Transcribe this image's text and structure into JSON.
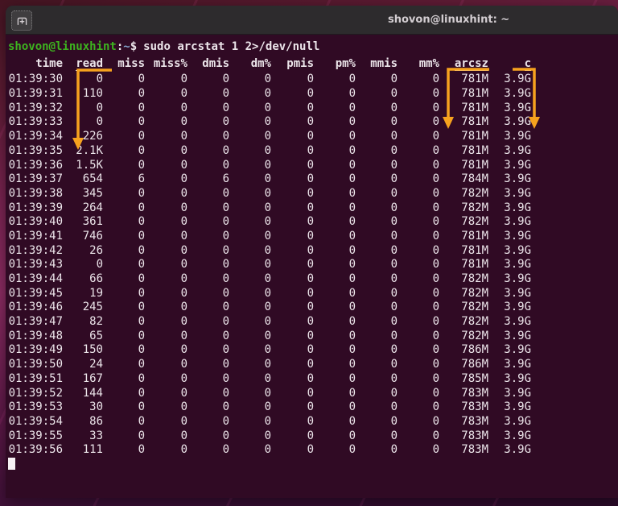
{
  "window": {
    "title": "shovon@linuxhint: ~"
  },
  "titlebar": {
    "new_tab_button": "new-tab"
  },
  "terminal": {
    "prompt": {
      "user_host": "shovon@linuxhint",
      "colon": ":",
      "path": "~",
      "symbol": "$"
    },
    "command": "sudo arcstat 1 2>/dev/null",
    "cursor": "block"
  },
  "table": {
    "columns": [
      "time",
      "read",
      "miss",
      "miss%",
      "dmis",
      "dm%",
      "pmis",
      "pm%",
      "mmis",
      "mm%",
      "arcsz",
      "c"
    ],
    "underlined_columns": [
      "read",
      "arcsz",
      "c"
    ],
    "rows": [
      [
        "01:39:30",
        "0",
        "0",
        "0",
        "0",
        "0",
        "0",
        "0",
        "0",
        "0",
        "781M",
        "3.9G"
      ],
      [
        "01:39:31",
        "110",
        "0",
        "0",
        "0",
        "0",
        "0",
        "0",
        "0",
        "0",
        "781M",
        "3.9G"
      ],
      [
        "01:39:32",
        "0",
        "0",
        "0",
        "0",
        "0",
        "0",
        "0",
        "0",
        "0",
        "781M",
        "3.9G"
      ],
      [
        "01:39:33",
        "0",
        "0",
        "0",
        "0",
        "0",
        "0",
        "0",
        "0",
        "0",
        "781M",
        "3.9G"
      ],
      [
        "01:39:34",
        "226",
        "0",
        "0",
        "0",
        "0",
        "0",
        "0",
        "0",
        "0",
        "781M",
        "3.9G"
      ],
      [
        "01:39:35",
        "2.1K",
        "0",
        "0",
        "0",
        "0",
        "0",
        "0",
        "0",
        "0",
        "781M",
        "3.9G"
      ],
      [
        "01:39:36",
        "1.5K",
        "0",
        "0",
        "0",
        "0",
        "0",
        "0",
        "0",
        "0",
        "781M",
        "3.9G"
      ],
      [
        "01:39:37",
        "654",
        "6",
        "0",
        "6",
        "0",
        "0",
        "0",
        "0",
        "0",
        "784M",
        "3.9G"
      ],
      [
        "01:39:38",
        "345",
        "0",
        "0",
        "0",
        "0",
        "0",
        "0",
        "0",
        "0",
        "782M",
        "3.9G"
      ],
      [
        "01:39:39",
        "264",
        "0",
        "0",
        "0",
        "0",
        "0",
        "0",
        "0",
        "0",
        "782M",
        "3.9G"
      ],
      [
        "01:39:40",
        "361",
        "0",
        "0",
        "0",
        "0",
        "0",
        "0",
        "0",
        "0",
        "782M",
        "3.9G"
      ],
      [
        "01:39:41",
        "746",
        "0",
        "0",
        "0",
        "0",
        "0",
        "0",
        "0",
        "0",
        "781M",
        "3.9G"
      ],
      [
        "01:39:42",
        "26",
        "0",
        "0",
        "0",
        "0",
        "0",
        "0",
        "0",
        "0",
        "781M",
        "3.9G"
      ],
      [
        "01:39:43",
        "0",
        "0",
        "0",
        "0",
        "0",
        "0",
        "0",
        "0",
        "0",
        "781M",
        "3.9G"
      ],
      [
        "01:39:44",
        "66",
        "0",
        "0",
        "0",
        "0",
        "0",
        "0",
        "0",
        "0",
        "782M",
        "3.9G"
      ],
      [
        "01:39:45",
        "19",
        "0",
        "0",
        "0",
        "0",
        "0",
        "0",
        "0",
        "0",
        "782M",
        "3.9G"
      ],
      [
        "01:39:46",
        "245",
        "0",
        "0",
        "0",
        "0",
        "0",
        "0",
        "0",
        "0",
        "782M",
        "3.9G"
      ],
      [
        "01:39:47",
        "82",
        "0",
        "0",
        "0",
        "0",
        "0",
        "0",
        "0",
        "0",
        "782M",
        "3.9G"
      ],
      [
        "01:39:48",
        "65",
        "0",
        "0",
        "0",
        "0",
        "0",
        "0",
        "0",
        "0",
        "782M",
        "3.9G"
      ],
      [
        "01:39:49",
        "150",
        "0",
        "0",
        "0",
        "0",
        "0",
        "0",
        "0",
        "0",
        "786M",
        "3.9G"
      ],
      [
        "01:39:50",
        "24",
        "0",
        "0",
        "0",
        "0",
        "0",
        "0",
        "0",
        "0",
        "786M",
        "3.9G"
      ],
      [
        "01:39:51",
        "167",
        "0",
        "0",
        "0",
        "0",
        "0",
        "0",
        "0",
        "0",
        "785M",
        "3.9G"
      ],
      [
        "01:39:52",
        "144",
        "0",
        "0",
        "0",
        "0",
        "0",
        "0",
        "0",
        "0",
        "783M",
        "3.9G"
      ],
      [
        "01:39:53",
        "30",
        "0",
        "0",
        "0",
        "0",
        "0",
        "0",
        "0",
        "0",
        "783M",
        "3.9G"
      ],
      [
        "01:39:54",
        "86",
        "0",
        "0",
        "0",
        "0",
        "0",
        "0",
        "0",
        "0",
        "783M",
        "3.9G"
      ],
      [
        "01:39:55",
        "33",
        "0",
        "0",
        "0",
        "0",
        "0",
        "0",
        "0",
        "0",
        "783M",
        "3.9G"
      ],
      [
        "01:39:56",
        "111",
        "0",
        "0",
        "0",
        "0",
        "0",
        "0",
        "0",
        "0",
        "783M",
        "3.9G"
      ]
    ]
  },
  "annotations": {
    "arrows": [
      "read-column-arrow",
      "arcsz-column-arrow",
      "c-column-arrow"
    ]
  },
  "colors": {
    "annotation_orange": "#f6a21e",
    "terminal_background": "#300a24",
    "prompt_green": "#3db41f",
    "prompt_path_blue": "#84a7cf",
    "titlebar_gray": "#2d2b2d"
  }
}
